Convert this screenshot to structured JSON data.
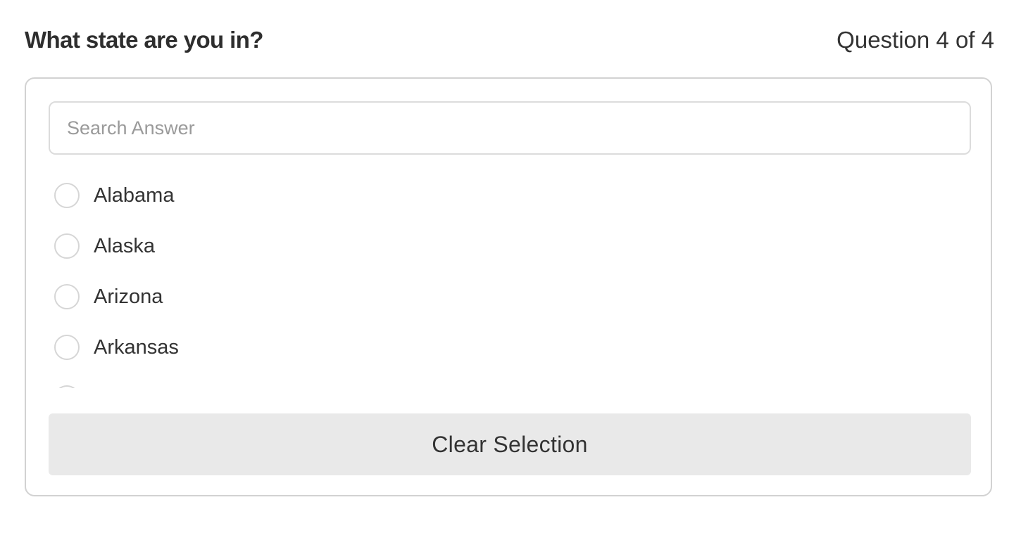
{
  "question": {
    "title": "What state are you in?",
    "counter": "Question 4 of 4"
  },
  "search": {
    "placeholder": "Search Answer",
    "value": ""
  },
  "options": [
    {
      "label": "Alabama"
    },
    {
      "label": "Alaska"
    },
    {
      "label": "Arizona"
    },
    {
      "label": "Arkansas"
    },
    {
      "label": ""
    }
  ],
  "clear_button": {
    "label": "Clear Selection"
  },
  "colors": {
    "card_border": "#d2d2d2",
    "radio_border": "#d6d6d6",
    "button_bg": "#e9e9e9",
    "text": "#333333",
    "placeholder": "#9a9a9a"
  }
}
